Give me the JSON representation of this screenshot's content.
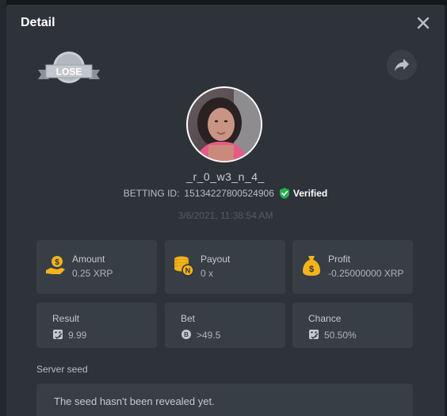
{
  "dialog": {
    "title": "Detail",
    "result_badge": "LOSE"
  },
  "player": {
    "username": "_r_0_w3_n_4_",
    "betting_id_label": "BETTING ID:",
    "betting_id": "15134227800524906",
    "verified_label": "Verified",
    "timestamp": "3/6/2021, 11:38:54 AM"
  },
  "stats": [
    {
      "label": "Amount",
      "value": "0.25 XRP",
      "icon": "money-hand-icon"
    },
    {
      "label": "Payout",
      "value": "0 x",
      "icon": "coin-stack-icon"
    },
    {
      "label": "Profit",
      "value": "-0.25000000 XRP",
      "icon": "money-bag-icon"
    }
  ],
  "details": [
    {
      "label": "Result",
      "value": "9.99",
      "icon": "dice-icon"
    },
    {
      "label": "Bet",
      "value": ">49.5",
      "icon": "target-icon"
    },
    {
      "label": "Chance",
      "value": "50.50%",
      "icon": "dice-icon"
    }
  ],
  "seed": {
    "label": "Server seed",
    "message": "The seed hasn't been revealed yet."
  },
  "colors": {
    "modal_bg": "#2d3339",
    "card_bg": "#383e45",
    "accent_gold": "#f2b31c",
    "verified_green": "#22b24c"
  }
}
